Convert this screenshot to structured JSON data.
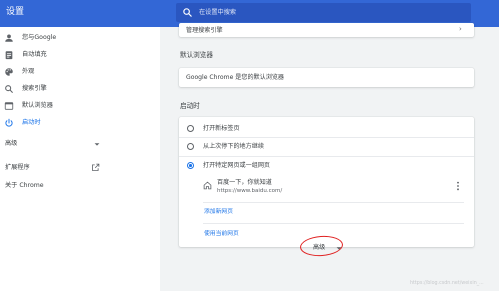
{
  "header": {
    "title": "设置",
    "search_placeholder": "在设置中搜索"
  },
  "sidebar": {
    "items": [
      {
        "label": "您与Google",
        "icon": "person-icon"
      },
      {
        "label": "自动填充",
        "icon": "autofill-clipboard-icon"
      },
      {
        "label": "外观",
        "icon": "palette-icon"
      },
      {
        "label": "搜索引擎",
        "icon": "search-icon"
      },
      {
        "label": "默认浏览器",
        "icon": "browser-window-icon"
      },
      {
        "label": "启动时",
        "icon": "power-icon",
        "active": true
      }
    ],
    "advanced_label": "高级",
    "extensions_label": "扩展程序",
    "about_label": "关于 Chrome"
  },
  "main": {
    "manage_search_engines": "管理搜索引擎",
    "default_browser_title": "默认浏览器",
    "default_browser_text": "Google Chrome 是您的默认浏览器",
    "startup_title": "启动时",
    "startup_options": [
      {
        "label": "打开新标签页",
        "checked": false
      },
      {
        "label": "从上次停下的地方继续",
        "checked": false
      },
      {
        "label": "打开特定网页或一组网页",
        "checked": true
      }
    ],
    "page_entry": {
      "title": "百度一下，你就知道",
      "url": "https://www.baidu.com/"
    },
    "add_new_page": "添加新网页",
    "use_current_pages": "使用当前网页",
    "advanced_button": "高级"
  },
  "watermark": "https://blog.csdn.net/weixin_...",
  "colors": {
    "topbar": "#3367d6",
    "accent": "#1a73e8",
    "annotation": "#e02020"
  }
}
